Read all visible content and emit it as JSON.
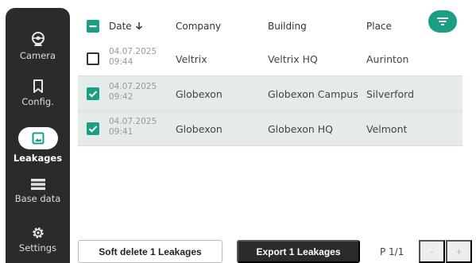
{
  "sidebar": {
    "items": [
      {
        "label": "Camera",
        "icon": "camera-icon"
      },
      {
        "label": "Config.",
        "icon": "bookmark-icon"
      },
      {
        "label": "Leakages",
        "icon": "image-icon",
        "active": true
      },
      {
        "label": "Base data",
        "icon": "list-icon"
      },
      {
        "label": "Settings",
        "icon": "gear-icon"
      }
    ]
  },
  "table": {
    "headers": {
      "date": "Date",
      "company": "Company",
      "building": "Building",
      "place": "Place"
    },
    "rows": [
      {
        "date": "04.07.2025",
        "time": "09:44",
        "company": "Veltrix",
        "building": "Veltrix HQ",
        "place": "Aurinton",
        "selected": false
      },
      {
        "date": "04.07.2025",
        "time": "09:42",
        "company": "Globexon",
        "building": "Globexon Campus",
        "place": "Silverford",
        "selected": true
      },
      {
        "date": "04.07.2025",
        "time": "09:41",
        "company": "Globexon",
        "building": "Globexon HQ",
        "place": "Velmont",
        "selected": true
      }
    ]
  },
  "footer": {
    "soft_delete_label": "Soft delete 1 Leakages",
    "export_label": "Export 1 Leakages",
    "page": "P 1/1",
    "prev_label": "-",
    "next_label": "+"
  },
  "colors": {
    "accent": "#1a9e84",
    "sidebar": "#2b2b2b",
    "selected_row": "#e4ebe9"
  }
}
